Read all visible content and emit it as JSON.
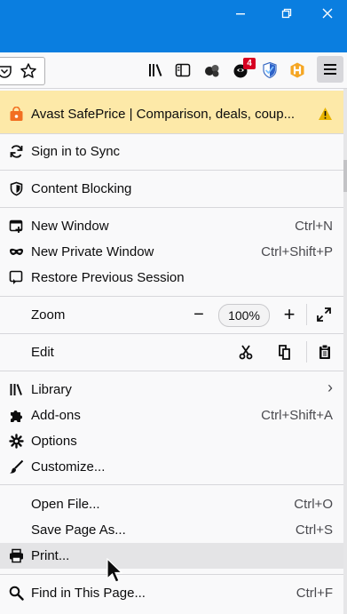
{
  "window": {
    "controls": [
      "minimize-icon",
      "restore-icon",
      "close-icon"
    ]
  },
  "toolbar": {
    "icons": [
      "pocket-icon",
      "bookmark-star-icon",
      "library-icon",
      "sidebar-icon",
      "extension-icon",
      "extension-icon",
      "shield-extension-icon",
      "honey-extension-icon",
      "hamburger-menu-icon"
    ],
    "badge": "4",
    "colors": {
      "badge": "#d70022",
      "titlebar": "#0a7ee0",
      "banner": "#fde9a8"
    }
  },
  "menu": {
    "banner": {
      "label": "Avast SafePrice | Comparison, deals, coup...",
      "icon": "warning-icon"
    },
    "sync": {
      "label": "Sign in to Sync"
    },
    "blocking": {
      "label": "Content Blocking"
    },
    "new_window": {
      "label": "New Window",
      "shortcut": "Ctrl+N"
    },
    "private_window": {
      "label": "New Private Window",
      "shortcut": "Ctrl+Shift+P"
    },
    "restore": {
      "label": "Restore Previous Session"
    },
    "zoom": {
      "label": "Zoom",
      "value": "100%",
      "minus": "−",
      "plus": "+"
    },
    "edit": {
      "label": "Edit"
    },
    "library": {
      "label": "Library",
      "arrow": "›"
    },
    "addons": {
      "label": "Add-ons",
      "shortcut": "Ctrl+Shift+A"
    },
    "options": {
      "label": "Options"
    },
    "customize": {
      "label": "Customize..."
    },
    "open_file": {
      "label": "Open File...",
      "shortcut": "Ctrl+O"
    },
    "save_page": {
      "label": "Save Page As...",
      "shortcut": "Ctrl+S"
    },
    "print": {
      "label": "Print..."
    },
    "find": {
      "label": "Find in This Page...",
      "shortcut": "Ctrl+F"
    }
  }
}
